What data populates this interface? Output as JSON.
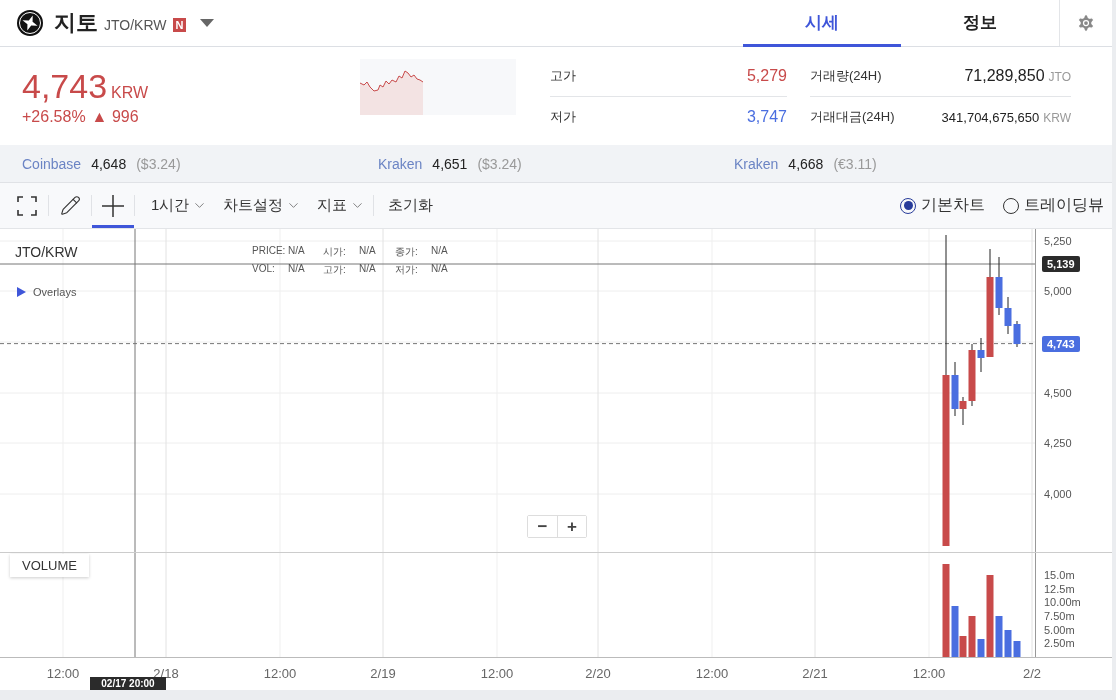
{
  "header": {
    "name": "지토",
    "pair": "JTO/KRW",
    "badge": "N"
  },
  "tabs": [
    {
      "label": "시세",
      "selected": true
    },
    {
      "label": "정보",
      "selected": false
    }
  ],
  "price": {
    "value": "4,743",
    "unit": "KRW",
    "change_percent": "+26.58%",
    "arrow": "▲",
    "change": "996"
  },
  "stats": [
    {
      "label": "고가",
      "value": "5,279",
      "kind": "high"
    },
    {
      "label": "거래량(24H)",
      "value": "71,289,850",
      "unit": "JTO",
      "kind": "plain"
    },
    {
      "label": "저가",
      "value": "3,747",
      "kind": "low"
    },
    {
      "label": "거래대금(24H)",
      "value": "341,704,675,650",
      "unit": "KRW",
      "kind": "plain"
    }
  ],
  "exchanges": [
    {
      "name": "Coinbase",
      "price": "4,648",
      "converted": "($3.24)"
    },
    {
      "name": "Kraken",
      "price": "4,651",
      "converted": "($3.24)"
    },
    {
      "name": "Kraken",
      "price": "4,668",
      "converted": "(€3.11)"
    }
  ],
  "toolbar": {
    "tools": [
      {
        "kind": "fullscreen",
        "selected": false
      },
      {
        "kind": "pencil",
        "selected": false
      },
      {
        "kind": "crosshair",
        "selected": true
      }
    ],
    "dropdowns": [
      "1시간",
      "차트설정",
      "지표"
    ],
    "reset": "초기화",
    "chart_types": [
      {
        "label": "기본차트",
        "selected": true
      },
      {
        "label": "트레이딩뷰",
        "selected": false
      }
    ]
  },
  "chart": {
    "symbol": "JTO/KRW",
    "overlays": "Overlays",
    "legend": [
      {
        "label": "PRICE:",
        "value": "N/A"
      },
      {
        "label": "시가:",
        "value": "N/A"
      },
      {
        "label": "종가:",
        "value": "N/A"
      },
      {
        "label": "VOL:",
        "value": "N/A"
      },
      {
        "label": "고가:",
        "value": "N/A"
      },
      {
        "label": "저가:",
        "value": "N/A"
      }
    ],
    "price_ticks": [
      "5,250",
      "5,000",
      "4,500",
      "4,250",
      "4,000"
    ],
    "crosshair_price": "5,139",
    "current_price": "4,743",
    "zoom_buttons": [
      "−",
      "+"
    ],
    "volume_label": "VOLUME",
    "volume_ticks": [
      "15.0m",
      "12.5m",
      "10.00m",
      "7.50m",
      "5.00m",
      "2.50m"
    ],
    "time_ticks": [
      "12:00",
      "2/18",
      "12:00",
      "2/19",
      "12:00",
      "2/20",
      "12:00",
      "2/21",
      "12:00",
      "2/2"
    ],
    "crosshair_time": "02/17 20:00"
  }
}
